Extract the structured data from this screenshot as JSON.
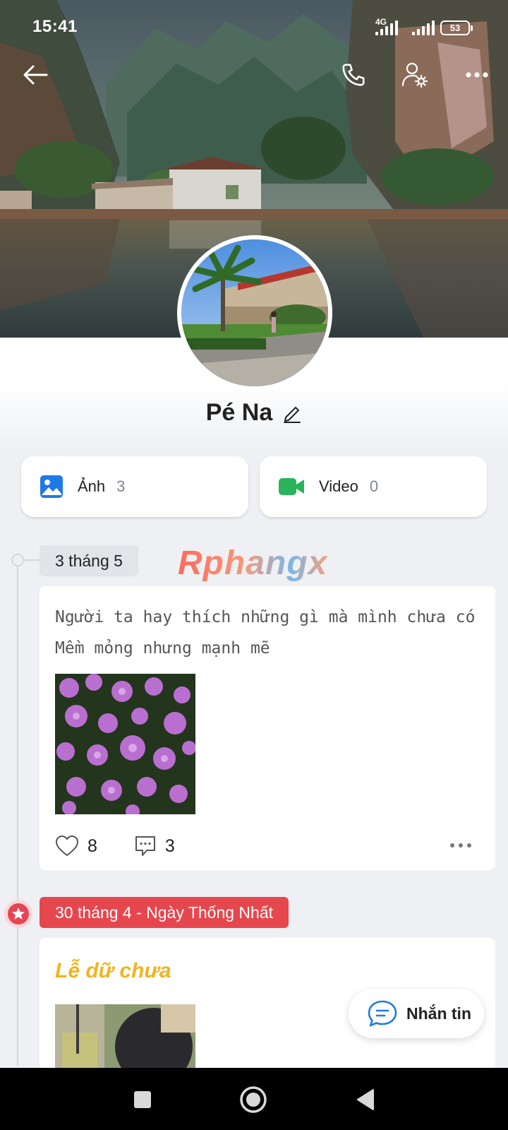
{
  "status_bar": {
    "time": "15:41",
    "network": "4G",
    "battery": "53"
  },
  "header": {
    "back_icon": "arrow-left-icon",
    "call_icon": "phone-icon",
    "settings_icon": "user-settings-icon",
    "more_icon": "more-horizontal-icon"
  },
  "profile": {
    "name": "Pé Na",
    "edit_icon": "pencil-icon"
  },
  "media": {
    "photos": {
      "label": "Ảnh",
      "count": "3",
      "icon": "image-icon",
      "color": "#1f7ae8"
    },
    "videos": {
      "label": "Video",
      "count": "0",
      "icon": "video-camera-icon",
      "color": "#29b45b"
    }
  },
  "watermark": "Rphangx",
  "timeline": [
    {
      "date": "3 tháng 5",
      "lines": [
        "Người ta hay thích những gì mà mình chưa có",
        "Mềm mỏng nhưng mạnh mẽ"
      ],
      "likes": "8",
      "comments": "3"
    },
    {
      "date": "30 tháng 4 - Ngày Thống Nhất",
      "title": "Lễ dữ chưa",
      "accent": "#e6474f"
    }
  ],
  "message_button": {
    "label": "Nhắn tin",
    "icon": "chat-bubble-icon",
    "color": "#1f7ae8"
  },
  "navbar": {
    "recent_icon": "square-icon",
    "home_icon": "circle-home-icon",
    "back_icon": "triangle-back-icon"
  }
}
